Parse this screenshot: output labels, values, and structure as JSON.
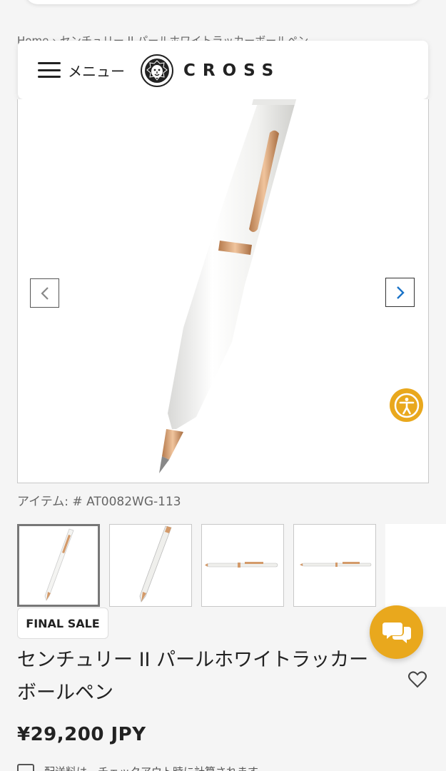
{
  "breadcrumb": "Home › センチュリー II パールホワイトラッカーボールペン",
  "header": {
    "menu_label": "メニュー",
    "brand": "CROSS"
  },
  "icons": {
    "menu": "hamburger-icon",
    "logo": "lion-icon",
    "prev": "chevron-left-icon",
    "next": "chevron-right-icon",
    "accessibility": "accessibility-icon",
    "wishlist": "heart-icon",
    "chat": "chat-bubbles-icon"
  },
  "product": {
    "item_id": "アイテム: # AT0082WG-113",
    "badge": "FINAL SALE",
    "title": "センチュリー II パールホワイトラッカーボールペン",
    "price": "¥29,200 JPY",
    "thumbnail_count": 5,
    "selected_thumbnail": 1
  },
  "bottom": {
    "text": "配送料は、チェックアウト時に計算されます。"
  },
  "colors": {
    "accent": "#e9a81d",
    "pen_body": "#f4f4f2",
    "pen_gold": "#d39a6a",
    "link_blue": "#1a73c8"
  }
}
